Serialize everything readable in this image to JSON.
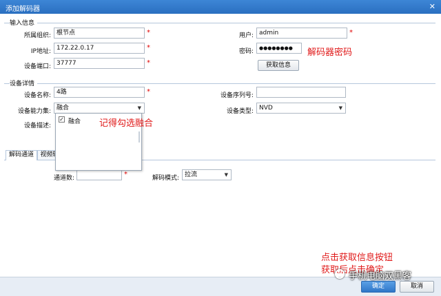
{
  "window": {
    "title": "添加解码器",
    "close_icon": "✕"
  },
  "input_info": {
    "section_title": "输入信息",
    "org_label": "所属组织:",
    "org_value": "根节点",
    "ip_label": "IP地址:",
    "ip_value": "172.22.0.17",
    "port_label": "设备端口:",
    "port_value": "37777",
    "user_label": "用户:",
    "user_value": "admin",
    "password_label": "密码:",
    "password_value": "●●●●●●●●",
    "get_info_label": "获取信息",
    "required_mark": "*"
  },
  "device_details": {
    "section_title": "设备详情",
    "name_label": "设备名称:",
    "name_value": "4路",
    "serial_label": "设备序列号:",
    "serial_value": "",
    "capability_label": "设备能力集:",
    "capability_value": "融合",
    "type_label": "设备类型:",
    "type_value": "NVD",
    "desc_label": "设备描述:",
    "capability_options": [
      {
        "label": "融合",
        "checked": true
      }
    ]
  },
  "tabs": [
    {
      "label": "解码通道",
      "active": true
    },
    {
      "label": "视频输"
    }
  ],
  "channel": {
    "count_label": "通道数:",
    "count_value": "",
    "mode_label": "解码模式:",
    "mode_value": "拉流"
  },
  "footer": {
    "ok_label": "确定",
    "cancel_label": "取消"
  },
  "annotations": {
    "password_note": "解码器密码",
    "fusion_note": "记得勾选融合",
    "bottom_note_line1": "点击获取信息按钮",
    "bottom_note_line2": "获取后点击确定"
  },
  "watermark": {
    "text": "手机电脑双黑客"
  },
  "colors": {
    "titlebar": "#2f78c8",
    "annotation": "#e01a1a",
    "required": "#e00000"
  }
}
